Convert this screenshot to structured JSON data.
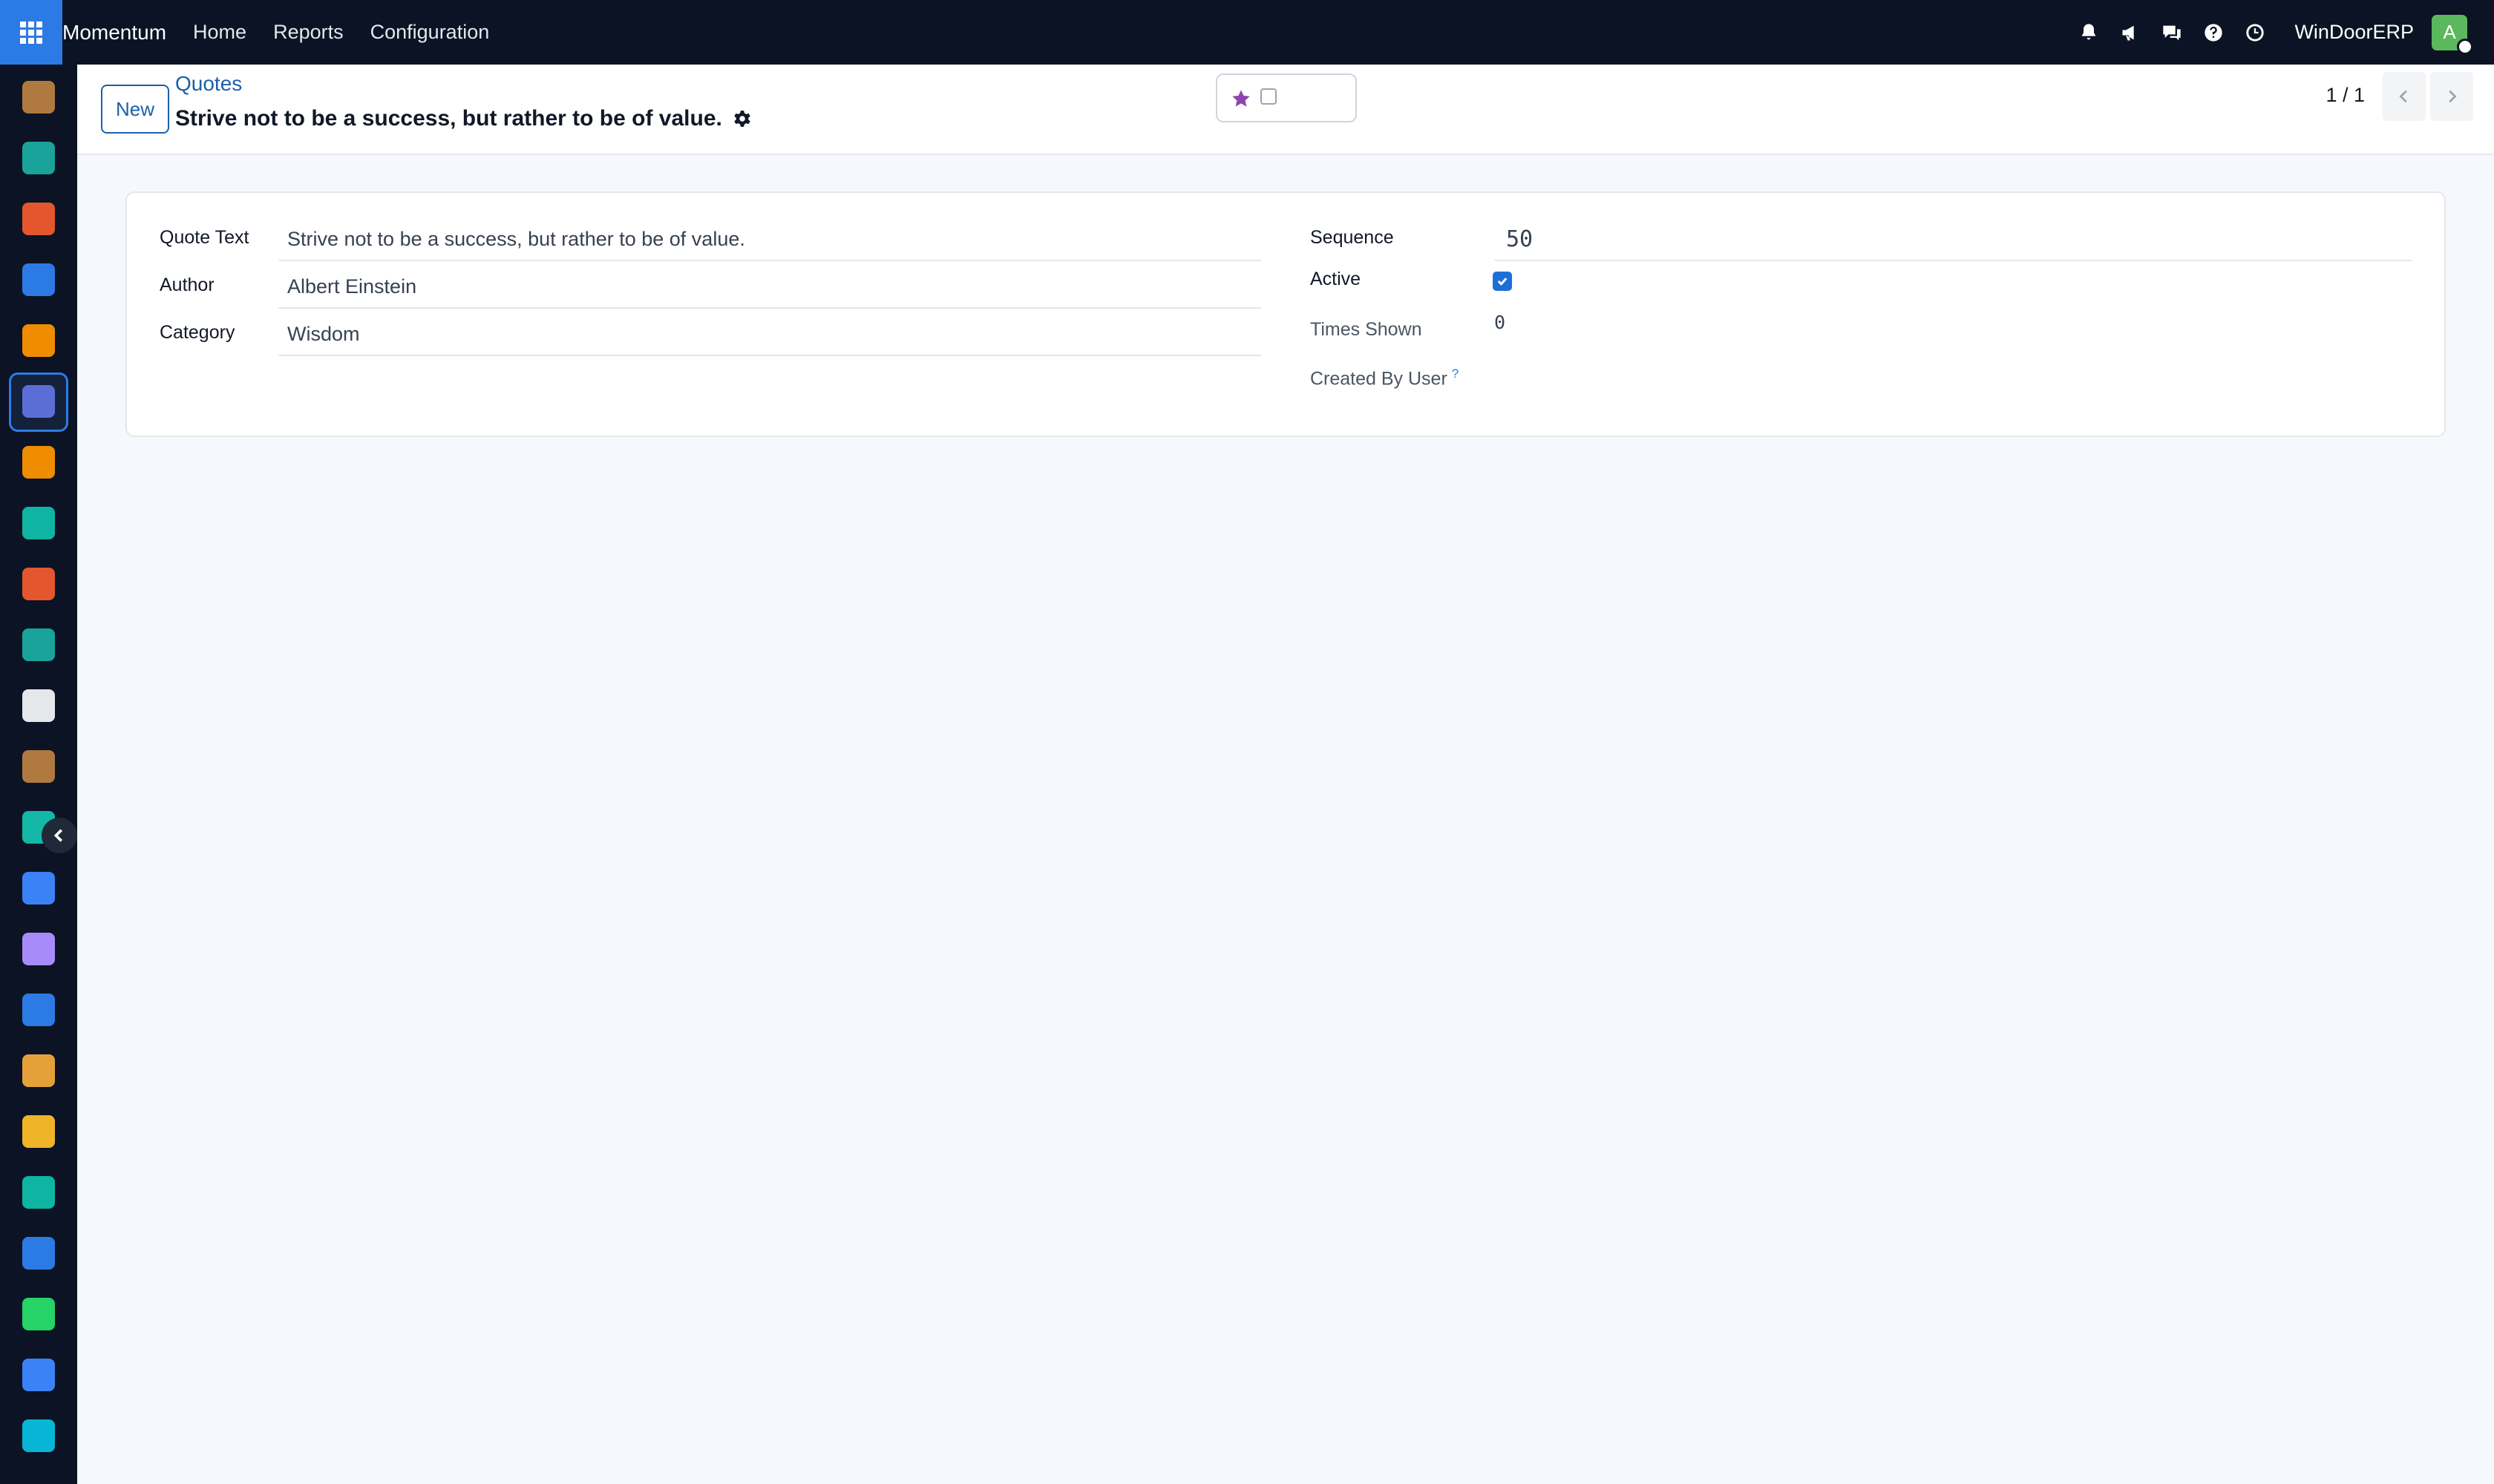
{
  "navbar": {
    "brand": "Momentum",
    "menu": [
      "Home",
      "Reports",
      "Configuration"
    ],
    "company": "WinDoorERP",
    "avatar_initial": "A",
    "icons": [
      "bell-icon",
      "megaphone-icon",
      "chat-icon",
      "help-icon",
      "clock-icon"
    ]
  },
  "sidebar": {
    "icons": [
      {
        "name": "app-icon-1",
        "color": "#b0793f"
      },
      {
        "name": "app-icon-contacts",
        "color": "#1aa39a"
      },
      {
        "name": "app-icon-reports",
        "color": "#e4572e"
      },
      {
        "name": "app-icon-pie",
        "color": "#2c7be5"
      },
      {
        "name": "app-icon-chat",
        "color": "#f08c00"
      },
      {
        "name": "app-icon-mail",
        "color": "#5b6ed8"
      },
      {
        "name": "app-icon-chat-2",
        "color": "#f08c00"
      },
      {
        "name": "app-icon-kanban",
        "color": "#10b4a2"
      },
      {
        "name": "app-icon-bars",
        "color": "#e4572e"
      },
      {
        "name": "app-icon-contacts-2",
        "color": "#1aa39a"
      },
      {
        "name": "app-icon-cube",
        "color": "#e5e7eb"
      },
      {
        "name": "app-icon-dev",
        "color": "#b0793f"
      },
      {
        "name": "app-icon-check",
        "color": "#14b8a6"
      },
      {
        "name": "app-icon-book",
        "color": "#3b82f6"
      },
      {
        "name": "app-icon-box",
        "color": "#a78bfa"
      },
      {
        "name": "app-icon-dollar",
        "color": "#2c7be5"
      },
      {
        "name": "app-icon-team",
        "color": "#e4a13a"
      },
      {
        "name": "app-icon-calendar",
        "color": "#f0b429"
      },
      {
        "name": "app-icon-sign",
        "color": "#10b4a2"
      },
      {
        "name": "app-icon-dashboard",
        "color": "#2c7be5"
      },
      {
        "name": "app-icon-whatsapp",
        "color": "#25d366"
      },
      {
        "name": "app-icon-gauge",
        "color": "#3b82f6"
      },
      {
        "name": "app-icon-wave",
        "color": "#06b6d4"
      }
    ]
  },
  "control": {
    "new_label": "New",
    "breadcrumb": "Quotes",
    "title": "Strive not to be a success, but rather to be of value.",
    "pager": "1 / 1"
  },
  "form": {
    "quote_text_label": "Quote Text",
    "quote_text_value": "Strive not to be a success, but rather to be of value.",
    "author_label": "Author",
    "author_value": "Albert Einstein",
    "category_label": "Category",
    "category_value": "Wisdom",
    "sequence_label": "Sequence",
    "sequence_value": "50",
    "active_label": "Active",
    "active_checked": true,
    "times_shown_label": "Times Shown",
    "times_shown_value": "0",
    "created_by_label": "Created By User",
    "help_mark": "?"
  }
}
